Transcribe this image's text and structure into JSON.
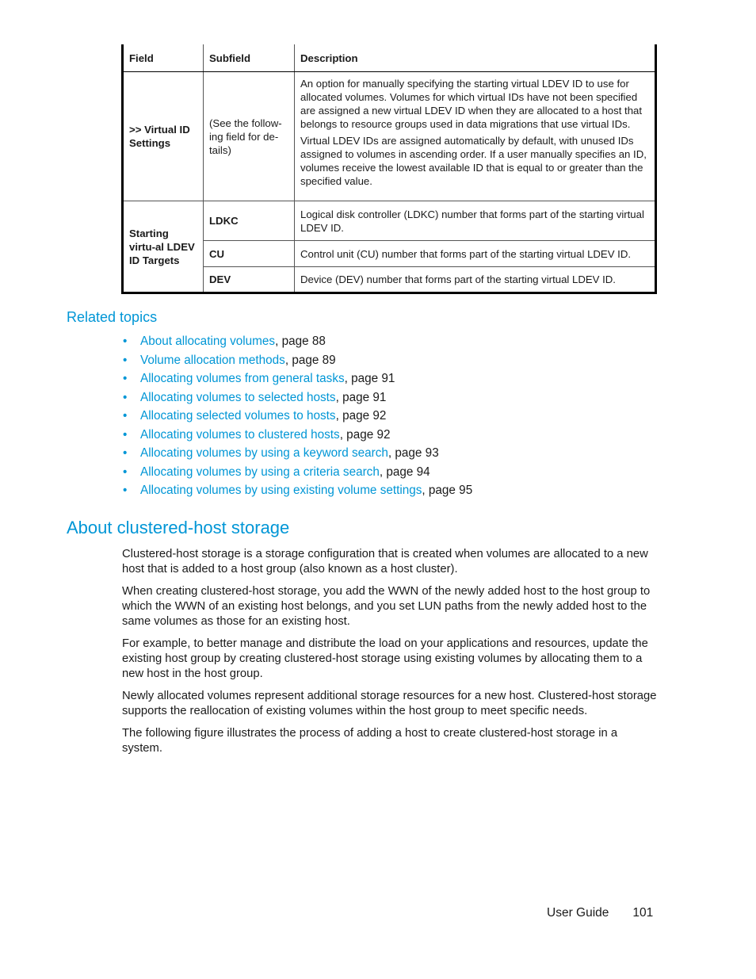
{
  "table": {
    "headers": [
      "Field",
      "Subfield",
      "Description"
    ],
    "row1": {
      "field": ">> Virtual ID Settings",
      "subfield": "(See the follow-ing field for de-tails)",
      "description": [
        "An option for manually specifying the starting virtual LDEV ID to use for allocated volumes. Volumes for which virtual IDs have not been specified are assigned a new virtual LDEV ID when they are allocated to a host that belongs to resource groups used in data migrations that use virtual IDs.",
        "Virtual LDEV IDs are assigned automatically by default, with unused IDs assigned to volumes in ascending order. If a user manually specifies an ID, volumes receive the lowest available ID that is equal to or greater than the specified value."
      ]
    },
    "row2": {
      "field": "Starting virtu-al LDEV ID Targets",
      "subrows": [
        {
          "subfield": "LDKC",
          "description": "Logical disk controller (LDKC) number that forms part of the starting virtual LDEV ID."
        },
        {
          "subfield": "CU",
          "description": "Control unit (CU) number that forms part of the starting virtual LDEV ID."
        },
        {
          "subfield": "DEV",
          "description": "Device (DEV) number that forms part of the starting virtual LDEV ID."
        }
      ]
    }
  },
  "related": {
    "title": "Related topics",
    "bullet": "•",
    "items": [
      {
        "link": "About allocating volumes",
        "page": ", page 88"
      },
      {
        "link": "Volume allocation methods",
        "page": ", page 89"
      },
      {
        "link": "Allocating volumes from general tasks",
        "page": ", page 91"
      },
      {
        "link": "Allocating volumes to selected hosts",
        "page": ", page 91"
      },
      {
        "link": "Allocating selected volumes to hosts",
        "page": ", page 92"
      },
      {
        "link": "Allocating volumes to clustered hosts",
        "page": ", page 92"
      },
      {
        "link": "Allocating volumes by using a keyword search",
        "page": ", page 93"
      },
      {
        "link": "Allocating volumes by using a criteria search",
        "page": ", page 94"
      },
      {
        "link": "Allocating volumes by using existing volume settings",
        "page": ", page 95"
      }
    ]
  },
  "section": {
    "title": "About clustered-host storage",
    "paragraphs": [
      "Clustered-host storage is a storage configuration that is created when volumes are allocated to a new host that is added to a host group (also known as a host cluster).",
      "When creating clustered-host storage, you add the WWN of the newly added host to the host group to which the WWN of an existing host belongs, and you set LUN paths from the newly added host to the same volumes as those for an existing host.",
      "For example, to better manage and distribute the load on your applications and resources, update the existing host group by creating clustered-host storage using existing volumes by allocating them to a new host in the host group.",
      "Newly allocated volumes represent additional storage resources for a new host. Clustered-host storage supports the reallocation of existing volumes within the host group to meet specific needs.",
      "The following figure illustrates the process of adding a host to create clustered-host storage in a system."
    ]
  },
  "footer": {
    "label": "User Guide",
    "page_number": "101"
  },
  "colors": {
    "accent": "#0096d6",
    "text": "#1a1a1a"
  }
}
